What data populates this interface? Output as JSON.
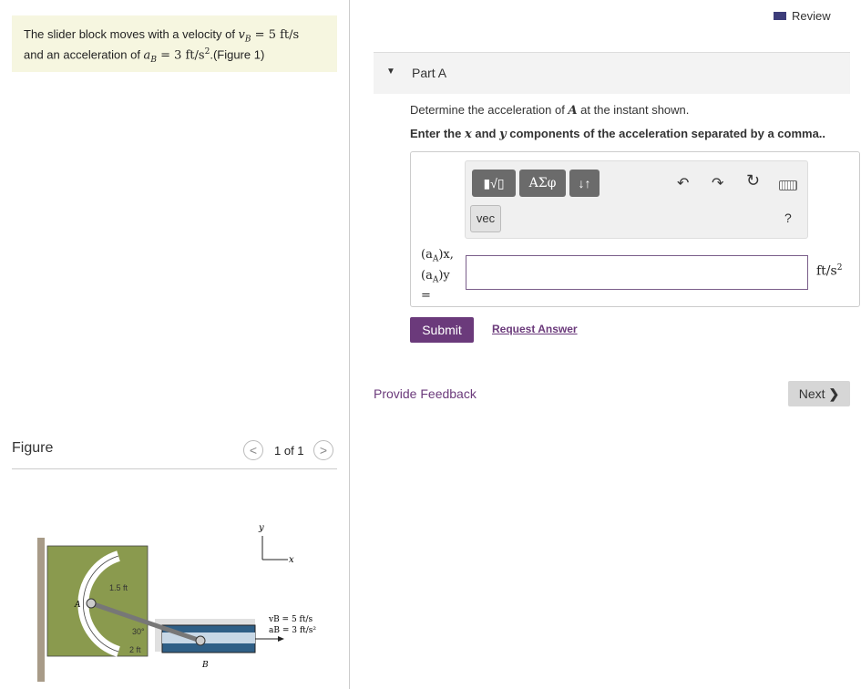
{
  "problem": {
    "text1": "The slider block moves with a velocity of ",
    "math1": "v",
    "math1_sub": "B",
    "math1_rest": " = 5 ft/s",
    "text2": "and an acceleration of ",
    "math2": "a",
    "math2_sub": "B",
    "math2_rest": " = 3 ft/s",
    "math2_sup": "2",
    "figure_link": ".(Figure 1)"
  },
  "figure_panel": {
    "title": "Figure",
    "pager": "1 of 1",
    "prev": "<",
    "next": ">",
    "labels": {
      "y_axis": "y",
      "x_axis": "x",
      "dim_r": "1.5 ft",
      "dim_l": "2 ft",
      "angle": "30°",
      "point_a": "A",
      "point_b": "B",
      "vb": "vB = 5 ft/s",
      "ab": "aB = 3 ft/s²"
    }
  },
  "header": {
    "review": "Review"
  },
  "part": {
    "arrow": "▼",
    "title": "Part A"
  },
  "question": {
    "line1a": "Determine the acceleration of ",
    "line1var": "A",
    "line1b": " at the instant shown.",
    "line2a": "Enter the ",
    "line2x": "x",
    "line2b": " and ",
    "line2y": "y",
    "line2c": " components of the acceleration separated by a comma.."
  },
  "toolbar": {
    "templates": "▮√▯",
    "greek": "ΑΣφ",
    "arrows": "↓↑",
    "vec": "vec",
    "undo": "↶",
    "redo": "↷",
    "reset": "↻",
    "help": "?"
  },
  "answer": {
    "label1": "(a",
    "label_sub": "A",
    "label_x": ")x,",
    "label_y": ")y",
    "eq": "=",
    "value": "",
    "units": "ft/s",
    "units_sup": "2"
  },
  "actions": {
    "submit": "Submit",
    "request": "Request Answer",
    "feedback": "Provide Feedback",
    "next": "Next"
  },
  "colors": {
    "accent": "#6b3a7b",
    "problem_bg": "#f6f6e0",
    "toolbar_btn": "#6b6b6b"
  }
}
